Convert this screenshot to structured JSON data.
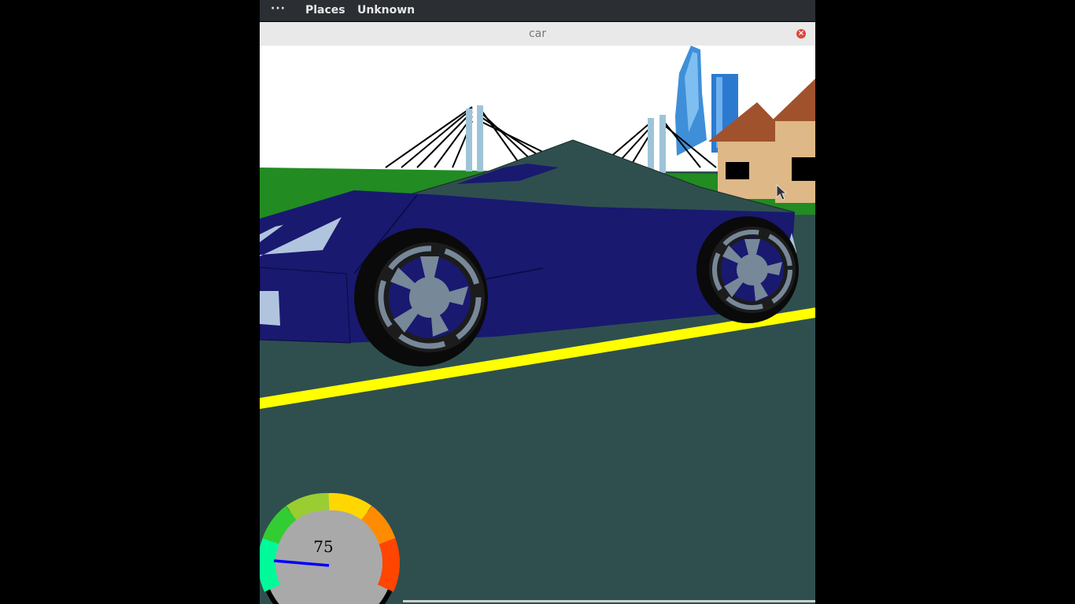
{
  "topbar": {
    "dots": "···",
    "places": "Places",
    "unknown": "Unknown"
  },
  "window": {
    "title": "car",
    "close_icon": "close-icon"
  },
  "hud": {
    "speed_value": "75",
    "speed_level": 0.75
  },
  "colors": {
    "sky": "#ffffff",
    "grass": "#228b22",
    "road": "#2f4f4f",
    "road_line": "#ffff00",
    "car_body": "#191970",
    "needle": "#0000ff"
  }
}
